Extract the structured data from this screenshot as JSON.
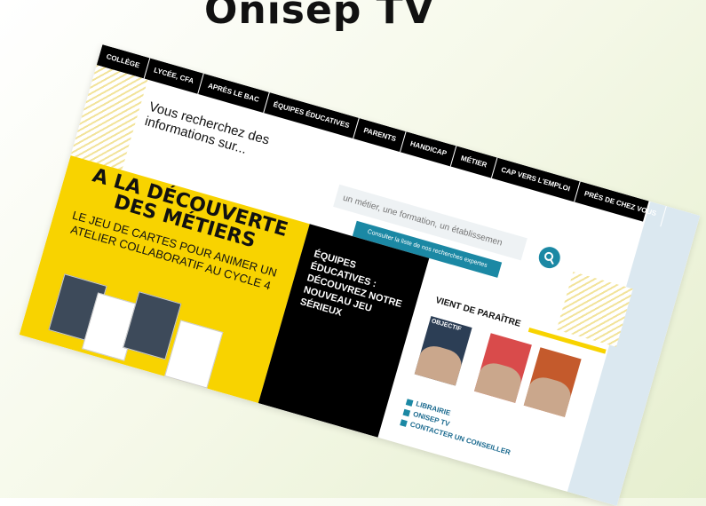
{
  "title": "Onisep TV",
  "nav": {
    "items": [
      "COLLÈGE",
      "LYCÉE, CFA",
      "APRÈS LE BAC",
      "ÉQUIPES ÉDUCATIVES",
      "PARENTS",
      "HANDICAP",
      "MÉTIER",
      "CAP VERS L'EMPLOI",
      "PRÈS DE CHEZ VOUS"
    ]
  },
  "search": {
    "prompt": "Vous recherchez des informations sur...",
    "placeholder": "un métier, une formation, un établissemen",
    "expert_label": "Consulter la liste de nos recherches expertes"
  },
  "banner": {
    "title": "A LA DÉCOUVERTE DES MÉTIERS",
    "subtitle": "LE JEU DE CARTES POUR ANIMER UN ATELIER COLLABORATIF AU CYCLE 4"
  },
  "promo": {
    "text": "ÉQUIPES ÉDUCATIVES : DÉCOUVREZ NOTRE NOUVEAU JEU SÉRIEUX"
  },
  "new_releases": {
    "title": "VIENT DE PARAÎTRE",
    "covers": [
      {
        "color": "#2c3e55",
        "label": "OBJECTIF"
      },
      {
        "color": "#d94b4b",
        "label": ""
      },
      {
        "color": "#c45a2c",
        "label": ""
      }
    ]
  },
  "links": [
    "LIBRAIRIE",
    "ONISEP TV",
    "CONTACTER UN CONSEILLER"
  ],
  "colors": {
    "accent": "#1b88a4",
    "yellow": "#f8d300",
    "nav_bg": "#000000"
  }
}
